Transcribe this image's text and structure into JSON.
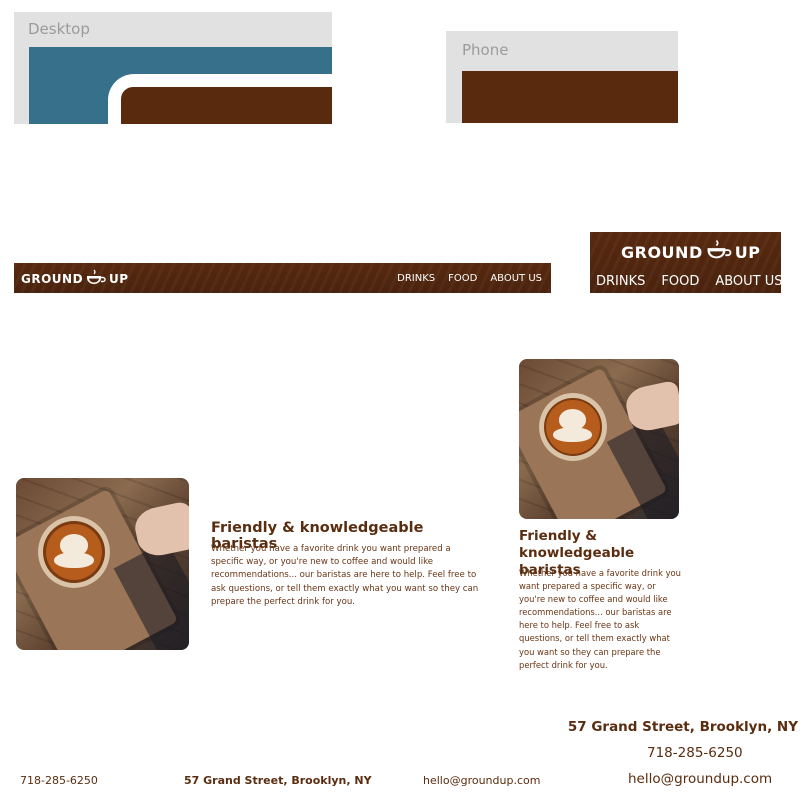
{
  "previews": {
    "desktop_label": "Desktop",
    "phone_label": "Phone"
  },
  "brand": {
    "logo_left": "GROUND",
    "logo_right": "UP"
  },
  "nav": {
    "items": [
      "DRINKS",
      "FOOD",
      "ABOUT US"
    ]
  },
  "feature": {
    "title": "Friendly & knowledgeable baristas",
    "body": "Whether you have a favorite drink you want prepared a specific way, or you're new to coffee and would like recommendations... our baristas are here to help. Feel free to ask questions, or tell them exactly what you want so they can prepare the perfect drink for you."
  },
  "footer": {
    "phone": "718-285-6250",
    "address": "57 Grand Street, Brooklyn, NY",
    "email": "hello@groundup.com"
  },
  "colors": {
    "brown": "#5a2a0e",
    "preview_bg": "#e1e1e1",
    "desktop_accent": "#36708a",
    "text_brown": "#6a3514"
  }
}
